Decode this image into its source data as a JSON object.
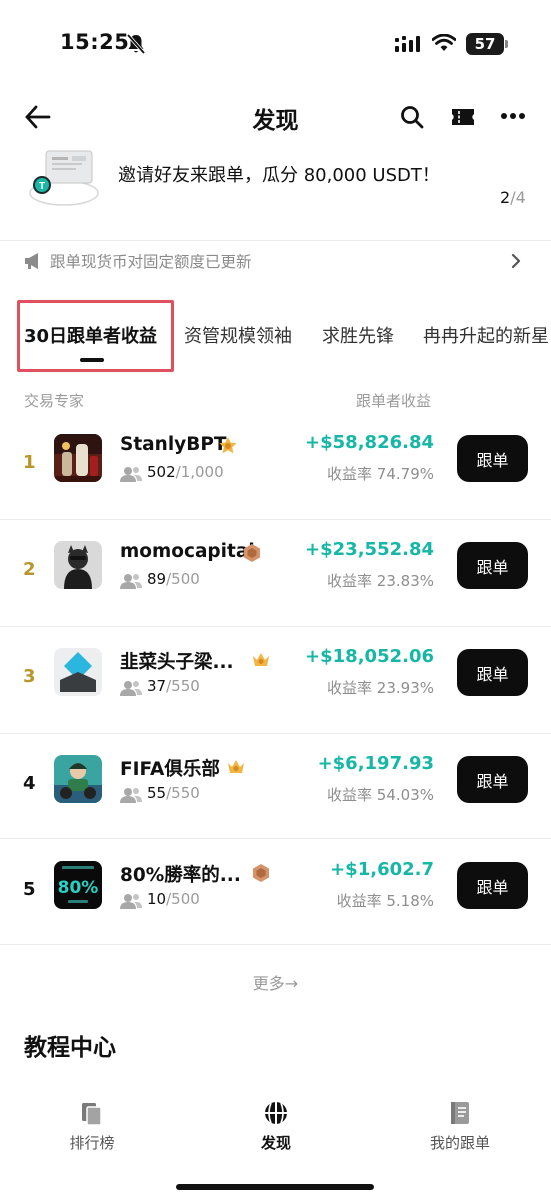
{
  "status_bar": {
    "time": "15:25",
    "battery": "57"
  },
  "header": {
    "title": "发现"
  },
  "banner": {
    "text": "邀请好友来跟单，瓜分 80,000 USDT！",
    "page_current": "2",
    "page_total": "/4"
  },
  "notice": {
    "text": "跟单现货币对固定额度已更新"
  },
  "tabs": [
    {
      "label": "30日跟单者收益",
      "active": true
    },
    {
      "label": "资管规模领袖",
      "active": false
    },
    {
      "label": "求胜先锋",
      "active": false
    },
    {
      "label": "冉冉升起的新星",
      "active": false
    }
  ],
  "columns": {
    "left": "交易专家",
    "right": "跟单者收益"
  },
  "leaders": [
    {
      "rank": "1",
      "name": "StanlyBPT",
      "followers": "502",
      "capacity": "/1,000",
      "profit": "+$58,826.84",
      "rate": "收益率 74.79%",
      "button": "跟单",
      "rank_color": "#b8962a",
      "badge": "gold-star"
    },
    {
      "rank": "2",
      "name": "momocapital",
      "followers": "89",
      "capacity": "/500",
      "profit": "+$23,552.84",
      "rate": "收益率 23.83%",
      "button": "跟单",
      "rank_color": "#b8962a",
      "badge": "bronze-hex"
    },
    {
      "rank": "3",
      "name": "韭菜头子梁...",
      "followers": "37",
      "capacity": "/550",
      "profit": "+$18,052.06",
      "rate": "收益率 23.93%",
      "button": "跟单",
      "rank_color": "#b8962a",
      "badge": "gold-crown"
    },
    {
      "rank": "4",
      "name": "FIFA俱乐部",
      "followers": "55",
      "capacity": "/550",
      "profit": "+$6,197.93",
      "rate": "收益率 54.03%",
      "button": "跟单",
      "rank_color": "#111111",
      "badge": "gold-crown"
    },
    {
      "rank": "5",
      "name": "80%勝率的...",
      "followers": "10",
      "capacity": "/500",
      "profit": "+$1,602.7",
      "rate": "收益率 5.18%",
      "button": "跟单",
      "rank_color": "#111111",
      "badge": "bronze-hex"
    }
  ],
  "avatar5_text": "80%",
  "more": {
    "label": "更多→"
  },
  "tutorial": {
    "title": "教程中心"
  },
  "bottom_nav": [
    {
      "label": "排行榜",
      "icon": "ranking-icon",
      "active": false
    },
    {
      "label": "发现",
      "icon": "discover-icon",
      "active": true
    },
    {
      "label": "我的跟单",
      "icon": "my-copy-icon",
      "active": false
    }
  ],
  "colors": {
    "profit": "#16b7a6",
    "highlight": "#e0505e",
    "button": "#0d0d0d"
  }
}
